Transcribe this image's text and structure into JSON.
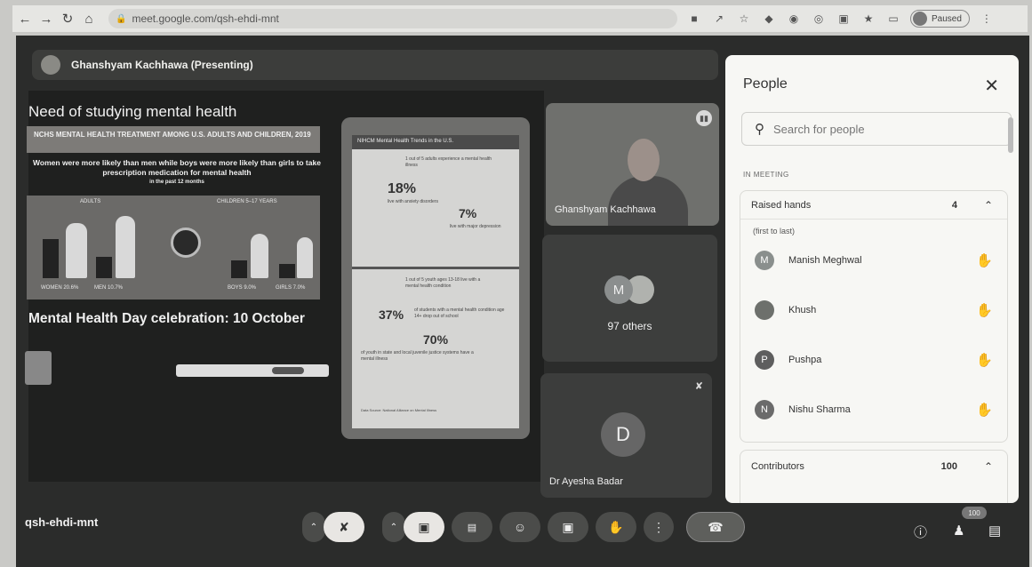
{
  "browser": {
    "url": "meet.google.com/qsh-ehdi-mnt",
    "paused_label": "Paused",
    "icons": [
      "back-icon",
      "forward-icon",
      "reload-icon",
      "home-icon",
      "lock-icon",
      "camera-blocked-icon",
      "share-icon",
      "star-icon",
      "extension-icons",
      "more-vert-icon"
    ]
  },
  "presentation": {
    "presenter_label": "Ghanshyam Kachhawa (Presenting)",
    "slide_title": "Need of studying mental health",
    "banner_text": "MENTAL HEALTH TREATMENT AMONG U.S. ADULTS AND CHILDREN, 2019",
    "banner_prefix": "NCHS",
    "subline": "Women were more likely than men while boys were more likely than girls to take prescription medication for mental health",
    "subline_small": "in the past 12 months",
    "labels": {
      "adults": "ADULTS",
      "children": "CHILDREN 5–17 YEARS",
      "women": "WOMEN 20.6%",
      "men": "MEN 10.7%",
      "boys": "BOYS 9.0%",
      "girls": "GIRLS 7.0%"
    },
    "day_text": "Mental Health Day celebration: 10 October",
    "poster": {
      "header": "NIHCM Mental Health Trends in the U.S.",
      "line1": "1 out of 5 adults experience a mental health illness",
      "stat1": "18%",
      "stat1_text": "live with anxiety disorders",
      "stat2": "7%",
      "stat2_text": "live with major depression",
      "line2": "1 out of 5 youth ages 13-18 live with a mental health condition",
      "stat3": "37%",
      "stat3_text": "of students with a mental health condition age 14+ drop out of school",
      "stat4": "70%",
      "stat4_text": "of youth in state and local juvenile justice systems have a mental illness",
      "footer": "Data Source: National Alliance on Mental Illness"
    }
  },
  "tiles": {
    "presenter_name": "Ghanshyam Kachhawa",
    "others_initial": "M",
    "others_label": "97 others",
    "dr_initial": "D",
    "dr_name": "Dr Ayesha Badar"
  },
  "people_panel": {
    "title": "People",
    "search_placeholder": "Search for people",
    "in_meeting_label": "IN MEETING",
    "raised_hands": {
      "label": "Raised hands",
      "count": "4",
      "order_note": "(first to last)",
      "people": [
        {
          "initial": "M",
          "name": "Manish Meghwal",
          "color": "#8a8f8d"
        },
        {
          "initial": "",
          "name": "Khush",
          "color": "#6d706c"
        },
        {
          "initial": "P",
          "name": "Pushpa",
          "color": "#5e5e5e"
        },
        {
          "initial": "N",
          "name": "Nishu Sharma",
          "color": "#6b6b6b"
        }
      ]
    },
    "contributors": {
      "label": "Contributors",
      "count": "100"
    }
  },
  "toolbar": {
    "meeting_code": "qsh-ehdi-mnt",
    "participants_badge": "100",
    "buttons": [
      "mic-options",
      "mic-off",
      "camera-options",
      "camera-off",
      "captions",
      "emoji",
      "present",
      "raise-hand",
      "more-options",
      "leave-call"
    ],
    "right_icons": [
      "info-icon",
      "people-icon",
      "chat-icon"
    ]
  }
}
